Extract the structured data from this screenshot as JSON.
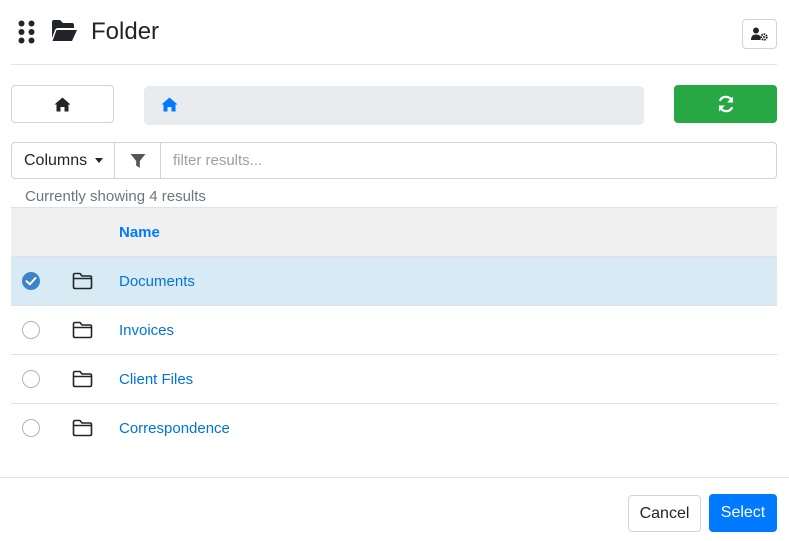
{
  "header": {
    "title": "Folder",
    "apps_icon": "grid-dots-icon",
    "title_icon": "folder-open-icon",
    "settings_icon": "user-gear-icon"
  },
  "toolbar": {
    "home_icon": "home-icon",
    "refresh_icon": "refresh-icon"
  },
  "breadcrumb": {
    "home_icon": "home-icon"
  },
  "filter": {
    "columns_label": "Columns",
    "filter_icon": "funnel-icon",
    "placeholder": "filter results..."
  },
  "results": {
    "count_text": "Currently showing 4 results"
  },
  "table": {
    "columns": [
      "Name"
    ],
    "rows": [
      {
        "name": "Documents",
        "selected": true
      },
      {
        "name": "Invoices",
        "selected": false
      },
      {
        "name": "Client Files",
        "selected": false
      },
      {
        "name": "Correspondence",
        "selected": false
      }
    ]
  },
  "footer": {
    "cancel_label": "Cancel",
    "select_label": "Select"
  },
  "colors": {
    "primary": "#007bff",
    "success": "#28a745",
    "selected_row": "#d8ebf5",
    "link": "#0074d9"
  }
}
